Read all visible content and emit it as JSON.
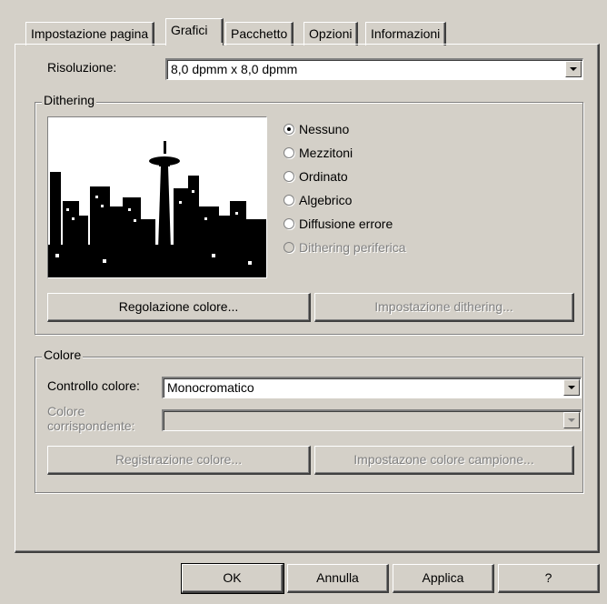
{
  "tabs": [
    {
      "label": "Impostazione pagina",
      "active": false
    },
    {
      "label": "Grafici",
      "active": true
    },
    {
      "label": "Pacchetto",
      "active": false
    },
    {
      "label": "Opzioni",
      "active": false
    },
    {
      "label": "Informazioni",
      "active": false
    }
  ],
  "resolution": {
    "label": "Risoluzione:",
    "value": "8,0 dpmm x 8,0 dpmm"
  },
  "dithering": {
    "group_label": "Dithering",
    "preview_icon": "seattle-skyline-dithered-preview",
    "options": [
      {
        "label": "Nessuno",
        "selected": true,
        "enabled": true
      },
      {
        "label": "Mezzitoni",
        "selected": false,
        "enabled": true
      },
      {
        "label": "Ordinato",
        "selected": false,
        "enabled": true
      },
      {
        "label": "Algebrico",
        "selected": false,
        "enabled": true
      },
      {
        "label": "Diffusione errore",
        "selected": false,
        "enabled": true
      },
      {
        "label": "Dithering periferica",
        "selected": false,
        "enabled": false
      }
    ],
    "color_adjust_button": "Regolazione colore...",
    "dithering_setup_button": "Impostazione dithering..."
  },
  "color": {
    "group_label": "Colore",
    "control_label": "Controllo colore:",
    "control_value": "Monocromatico",
    "match_label_line1": "Colore",
    "match_label_line2": "corrispondente:",
    "match_value": "",
    "register_button": "Registrazione colore...",
    "sample_button": "Impostazone colore campione..."
  },
  "footer": {
    "ok": "OK",
    "cancel": "Annulla",
    "apply": "Applica",
    "help": "?"
  },
  "colors": {
    "face": "#d4d0c8",
    "shadow": "#808080",
    "dark": "#404040",
    "highlight": "#ffffff"
  }
}
